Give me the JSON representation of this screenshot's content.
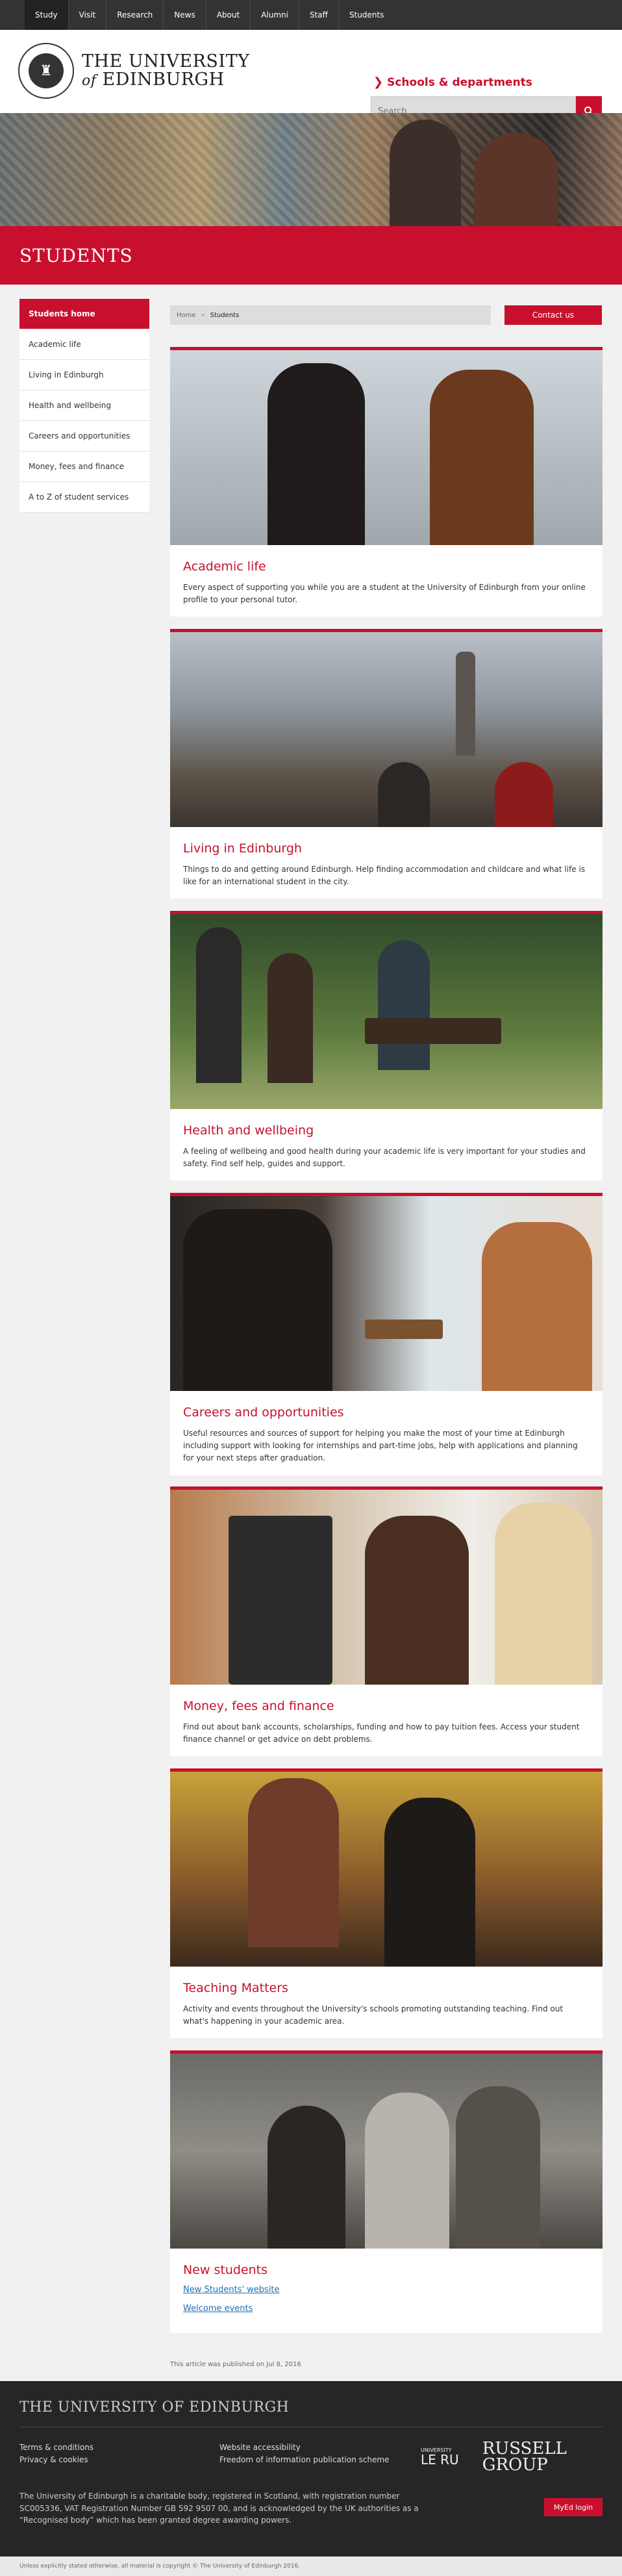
{
  "topnav": [
    "Study",
    "Visit",
    "Research",
    "News",
    "About",
    "Alumni",
    "Staff",
    "Students"
  ],
  "logo": {
    "line1": "THE UNIVERSITY",
    "of": "of",
    "line2": "EDINBURGH"
  },
  "schools_link": "Schools & departments",
  "search": {
    "placeholder": "Search"
  },
  "page_title": "STUDENTS",
  "sidenav": [
    "Students home",
    "Academic life",
    "Living in Edinburgh",
    "Health and wellbeing",
    "Careers and opportunities",
    "Money, fees and finance",
    "A to Z of student services"
  ],
  "breadcrumb": {
    "home": "Home",
    "current": "Students"
  },
  "contact_button": "Contact us",
  "cards": [
    {
      "title": "Academic life",
      "text": "Every aspect of supporting you while you are a student at the University of Edinburgh from your online profile to your personal tutor."
    },
    {
      "title": "Living in Edinburgh",
      "text": "Things to do and getting around Edinburgh. Help finding accommodation and childcare and what life is like for an international student in the city."
    },
    {
      "title": "Health and wellbeing",
      "text": "A feeling of wellbeing and good health during your academic life is very important for your studies and safety. Find self help, guides and support."
    },
    {
      "title": "Careers and opportunities",
      "text": "Useful resources and sources of support for helping you make the most of your time at Edinburgh including support with looking for internships and part-time jobs, help with applications and planning for your next steps after graduation."
    },
    {
      "title": "Money, fees and finance",
      "text": "Find out about bank accounts, scholarships, funding and how to pay tuition fees. Access your student finance channel or get advice on debt problems."
    },
    {
      "title": "Teaching Matters",
      "text": "Activity and events throughout the University's schools promoting outstanding teaching. Find out what's happening in your academic area."
    },
    {
      "title": "New students",
      "links": [
        "New Students' website",
        "Welcome events"
      ]
    }
  ],
  "published": "This article was published on Jul 8, 2016",
  "footer": {
    "title": "THE UNIVERSITY OF EDINBURGH",
    "links_left": [
      "Terms & conditions",
      "Privacy & cookies"
    ],
    "links_right": [
      "Website accessibility",
      "Freedom of information publication scheme"
    ],
    "legal": "The University of Edinburgh is a charitable body, registered in Scotland, with registration number SC005336, VAT Registration Number GB 592 9507 00, and is acknowledged by the UK authorities as a “Recognised body” which has been granted degree awarding powers.",
    "leru_small": "UNIVERSITY",
    "leru": "LE RU",
    "russell": "RUSSELL GROUP",
    "myed": "MyEd login"
  },
  "copyright": "Unless explicitly stated otherwise, all material is copyright © The University of Edinburgh 2016.",
  "colors": {
    "brand": "#c8102e",
    "nav": "#333333",
    "footer": "#262626"
  }
}
